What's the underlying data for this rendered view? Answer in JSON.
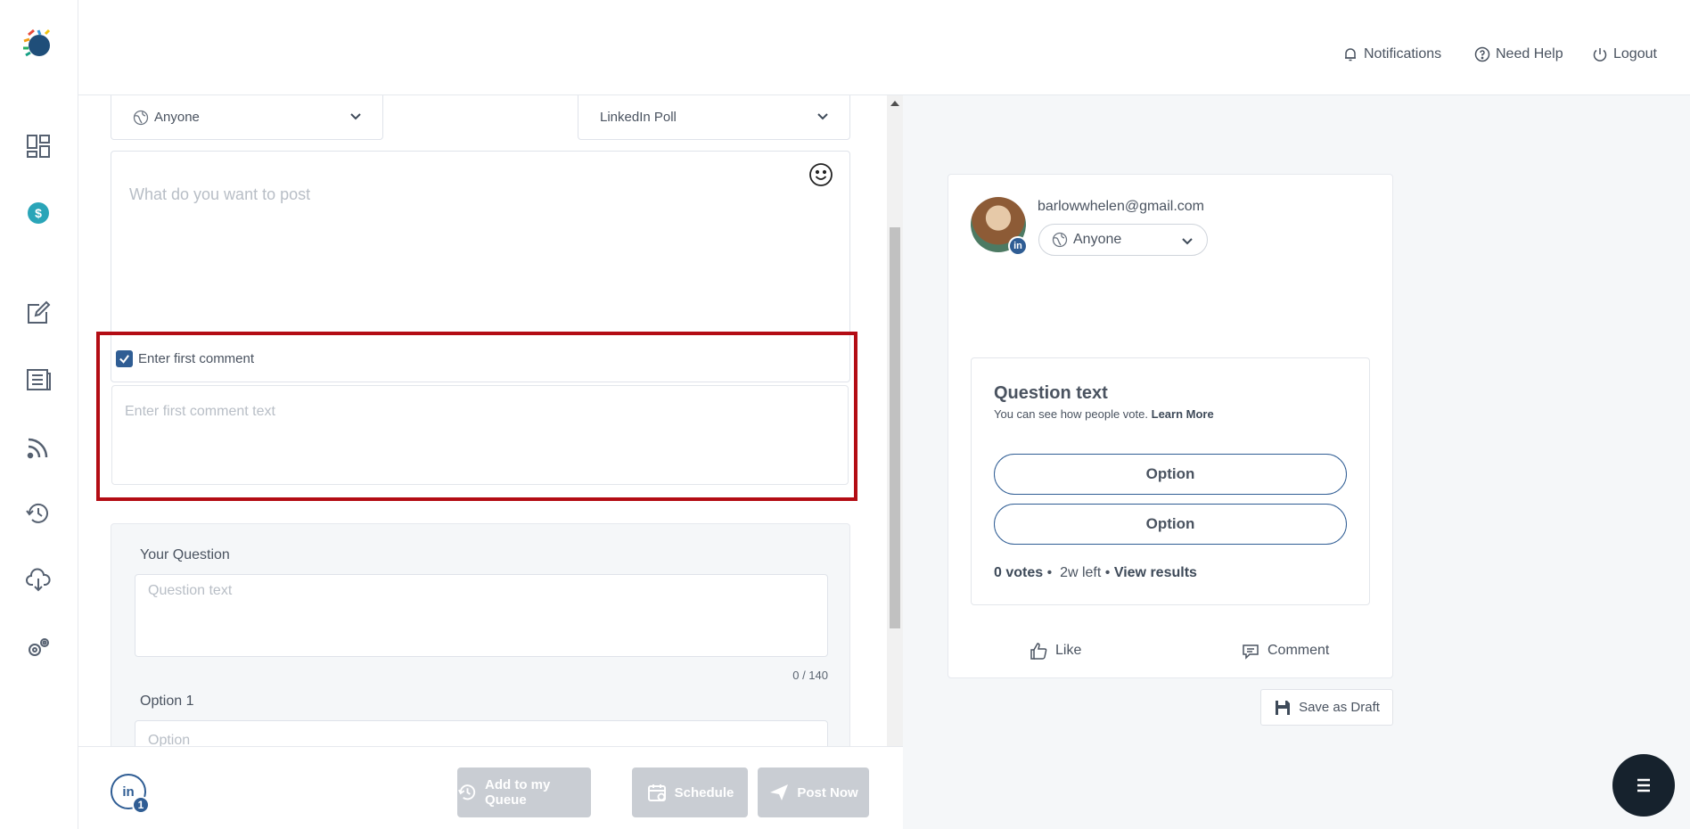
{
  "header": {
    "notifications": "Notifications",
    "help": "Need Help",
    "logout": "Logout"
  },
  "editor": {
    "visibility_value": "Anyone",
    "post_type_value": "LinkedIn Poll",
    "post_placeholder": "What do you want to post",
    "first_comment_label": "Enter first comment",
    "first_comment_checked": true,
    "first_comment_placeholder": "Enter first comment text",
    "question_label": "Your Question",
    "question_placeholder": "Question text",
    "question_counter": "0 / 140",
    "option1_label": "Option 1",
    "option1_placeholder": "Option"
  },
  "bottombar": {
    "account_network": "in",
    "account_count": "1",
    "queue_label": "Add to my Queue",
    "schedule_label": "Schedule",
    "post_now_label": "Post Now"
  },
  "preview": {
    "email": "barlowwhelen@gmail.com",
    "network_badge": "in",
    "visibility": "Anyone",
    "poll": {
      "question": "Question text",
      "subtitle": "You can see how people vote.",
      "learn_more": "Learn More",
      "options": [
        "Option",
        "Option"
      ],
      "votes": "0 votes",
      "time_left": "2w left",
      "view_results": "View results"
    },
    "like": "Like",
    "comment": "Comment",
    "save_draft": "Save as Draft"
  },
  "colors": {
    "accent": "#2f5d94",
    "highlight": "#b30c14",
    "fab": "#16222d"
  }
}
